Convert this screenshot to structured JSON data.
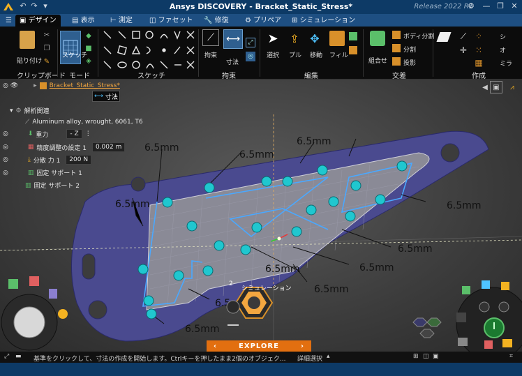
{
  "app": {
    "title": "Ansys DISCOVERY - Bracket_Static_Stress*",
    "release": "Release 2022 R1"
  },
  "tabs": [
    {
      "label": "デザイン"
    },
    {
      "label": "表示"
    },
    {
      "label": "測定"
    },
    {
      "label": "ファセット"
    },
    {
      "label": "修復"
    },
    {
      "label": "プリペア"
    },
    {
      "label": "シミュレーション"
    }
  ],
  "ribbon": {
    "clipboard_label": "クリップボード",
    "paste_label": "貼り付け",
    "mode_label": "モード",
    "sketch_button": "スケッチ",
    "sketch_group": "スケッチ",
    "constraint_group": "拘束",
    "constraint_label": "拘束",
    "dimension_label": "寸法",
    "edit_group": "編集",
    "select_label": "選択",
    "pull_label": "プル",
    "move_label": "移動",
    "fill_label": "フィル",
    "intersect_group": "交差",
    "combine_label": "組合せ",
    "split_body_label": "ボディ分割",
    "split_label": "分割",
    "project_label": "投影",
    "create_group": "作成",
    "create_items": [
      "シ",
      "オ",
      "ミラ"
    ]
  },
  "tree": {
    "root": "Bracket_Static_Stress*",
    "dimension_hint": "寸法",
    "analysis_root": "解析関連",
    "material": "Aluminum alloy, wrought, 6061, T6",
    "gravity_label": "重力",
    "gravity_value": "- Z",
    "fidelity_label": "精度調整の設定 1",
    "fidelity_value": "0.002 m",
    "force_label": "分散 力 1",
    "force_value": "200 N",
    "support1": "固定 サポート 1",
    "support2": "固定 サポート 2"
  },
  "dimensions": [
    "6.5mm",
    "6.5mm",
    "6.5mm",
    "6.5mm",
    "6.5mm",
    "6.5mm",
    "6.5mm",
    "6.5mm",
    "6.5mm",
    "6.5mm",
    "6.5mm"
  ],
  "viewport": {
    "simulation_label": "シミュレーション",
    "explore_label": "EXPLORE",
    "badge_count": "2"
  },
  "status": {
    "message": "基準をクリックして、寸法の作成を開始します。Ctrlキーを押したまま2個のオブジェク...",
    "detail_select": "詳細選択"
  },
  "colors": {
    "title_bg": "#0d3a66",
    "tab_bg": "#1e4f82",
    "part_fill": "#4a4a8f",
    "sketch_line": "#4aa8ff",
    "handle": "#20c7cf",
    "explore_orange": "#e26f10"
  }
}
